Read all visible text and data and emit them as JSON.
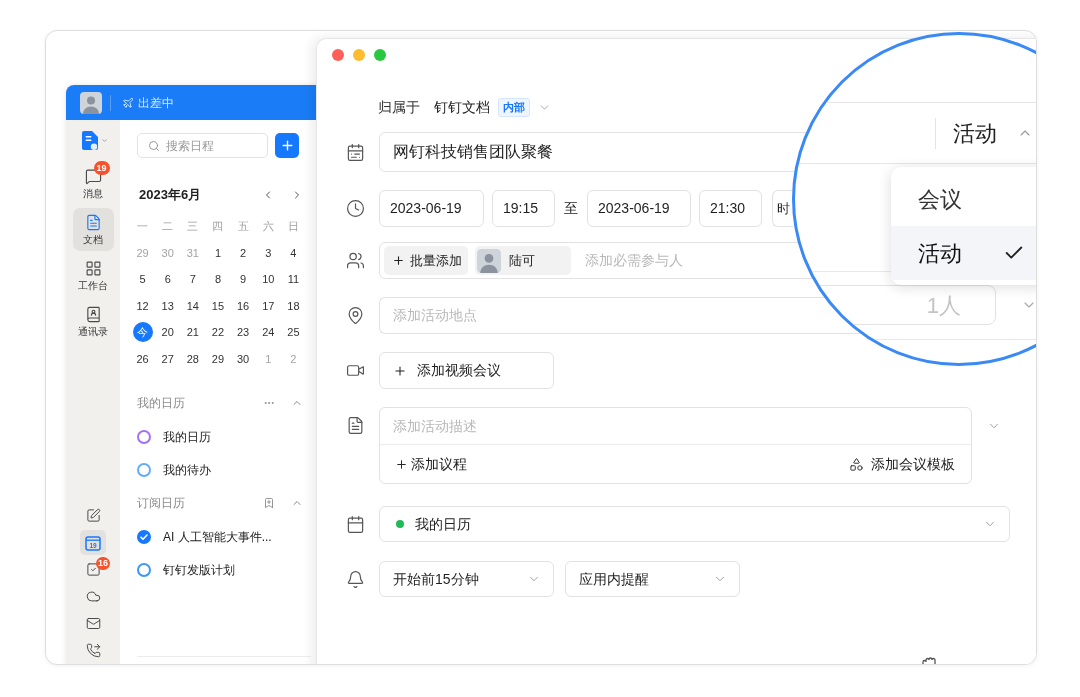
{
  "sidebar": {
    "status": "出差中",
    "nav_items": [
      {
        "kind": "app-switcher",
        "selected": false
      },
      {
        "kind": "messages",
        "label": "消息",
        "badge": "19",
        "selected": false
      },
      {
        "kind": "docs",
        "label": "文档",
        "selected": true
      },
      {
        "kind": "workbench",
        "label": "工作台",
        "selected": false
      },
      {
        "kind": "contacts",
        "label": "通讯录",
        "selected": false
      }
    ],
    "tool_items": [
      {
        "kind": "notes",
        "selected": false
      },
      {
        "kind": "calendar",
        "day": "19",
        "selected": true
      },
      {
        "kind": "todo",
        "badge": "16",
        "selected": false
      },
      {
        "kind": "cloud",
        "selected": false
      },
      {
        "kind": "mail",
        "selected": false
      },
      {
        "kind": "phone",
        "selected": false
      }
    ]
  },
  "calendar_panel": {
    "search": {
      "placeholder": "搜索日程"
    },
    "month": "2023年6月",
    "weekdays": [
      "一",
      "二",
      "三",
      "四",
      "五",
      "六",
      "日"
    ],
    "weeks": [
      [
        {
          "day": "29",
          "outside": true,
          "selected": false
        },
        {
          "day": "30",
          "outside": true,
          "selected": false
        },
        {
          "day": "31",
          "outside": true,
          "selected": false
        },
        {
          "day": "1",
          "outside": false,
          "selected": false
        },
        {
          "day": "2",
          "outside": false,
          "selected": false
        },
        {
          "day": "3",
          "outside": false,
          "selected": false
        },
        {
          "day": "4",
          "outside": false,
          "selected": false
        }
      ],
      [
        {
          "day": "5",
          "outside": false,
          "selected": false
        },
        {
          "day": "6",
          "outside": false,
          "selected": false
        },
        {
          "day": "7",
          "outside": false,
          "selected": false
        },
        {
          "day": "8",
          "outside": false,
          "selected": false
        },
        {
          "day": "9",
          "outside": false,
          "selected": false
        },
        {
          "day": "10",
          "outside": false,
          "selected": false
        },
        {
          "day": "11",
          "outside": false,
          "selected": false
        }
      ],
      [
        {
          "day": "12",
          "outside": false,
          "selected": false
        },
        {
          "day": "13",
          "outside": false,
          "selected": false
        },
        {
          "day": "14",
          "outside": false,
          "selected": false
        },
        {
          "day": "15",
          "outside": false,
          "selected": false
        },
        {
          "day": "16",
          "outside": false,
          "selected": false
        },
        {
          "day": "17",
          "outside": false,
          "selected": false
        },
        {
          "day": "18",
          "outside": false,
          "selected": false
        }
      ],
      [
        {
          "day": "今",
          "outside": false,
          "selected": true
        },
        {
          "day": "20",
          "outside": false,
          "selected": false
        },
        {
          "day": "21",
          "outside": false,
          "selected": false
        },
        {
          "day": "22",
          "outside": false,
          "selected": false
        },
        {
          "day": "23",
          "outside": false,
          "selected": false
        },
        {
          "day": "24",
          "outside": false,
          "selected": false
        },
        {
          "day": "25",
          "outside": false,
          "selected": false
        }
      ],
      [
        {
          "day": "26",
          "outside": false,
          "selected": false
        },
        {
          "day": "27",
          "outside": false,
          "selected": false
        },
        {
          "day": "28",
          "outside": false,
          "selected": false
        },
        {
          "day": "29",
          "outside": false,
          "selected": false
        },
        {
          "day": "30",
          "outside": false,
          "selected": false
        },
        {
          "day": "1",
          "outside": true,
          "selected": false
        },
        {
          "day": "2",
          "outside": true,
          "selected": false
        }
      ]
    ],
    "sections": [
      {
        "title": "我的日历",
        "kind": "mine",
        "expanded": true,
        "calendars": [
          {
            "name": "我的日历",
            "color": "#a372f2",
            "checked": false
          },
          {
            "name": "我的待办",
            "color": "#62adf9",
            "checked": false
          }
        ]
      },
      {
        "title": "订阅日历",
        "kind": "subscribed",
        "expanded": true,
        "calendars": [
          {
            "name": "AI 人工智能大事件...",
            "color": "#1677ff",
            "checked": true
          },
          {
            "name": "钉钉发版计划",
            "color": "#3d97f7",
            "checked": false
          }
        ]
      }
    ]
  },
  "event_form": {
    "owner": {
      "label": "归属于",
      "value": "钉钉文档",
      "tag": "内部"
    },
    "title": {
      "value": "网钉科技销售团队聚餐"
    },
    "time": {
      "start_date": "2023-06-19",
      "start_time": "19:15",
      "separator": "至",
      "end_date": "2023-06-19",
      "end_time": "21:30",
      "timezone": "时"
    },
    "attendees": {
      "bulk_add": "批量添加",
      "people": [
        {
          "name": "陆可"
        }
      ],
      "placeholder": "添加必需参与人"
    },
    "location": {
      "placeholder": "添加活动地点"
    },
    "video": {
      "label": "添加视频会议"
    },
    "description": {
      "placeholder": "添加活动描述",
      "agenda": "添加议程",
      "template": "添加会议模板"
    },
    "calendar": {
      "value": "我的日历",
      "color": "#1fba58"
    },
    "reminders": [
      {
        "value": "开始前15分钟"
      },
      {
        "value": "应用内提醒"
      }
    ]
  },
  "magnifier": {
    "type": {
      "value": "活动",
      "expanded": true
    },
    "options": [
      {
        "label": "会议",
        "selected": false
      },
      {
        "label": "活动",
        "selected": true
      }
    ],
    "attendee_limit": {
      "placeholder": "1人"
    }
  }
}
